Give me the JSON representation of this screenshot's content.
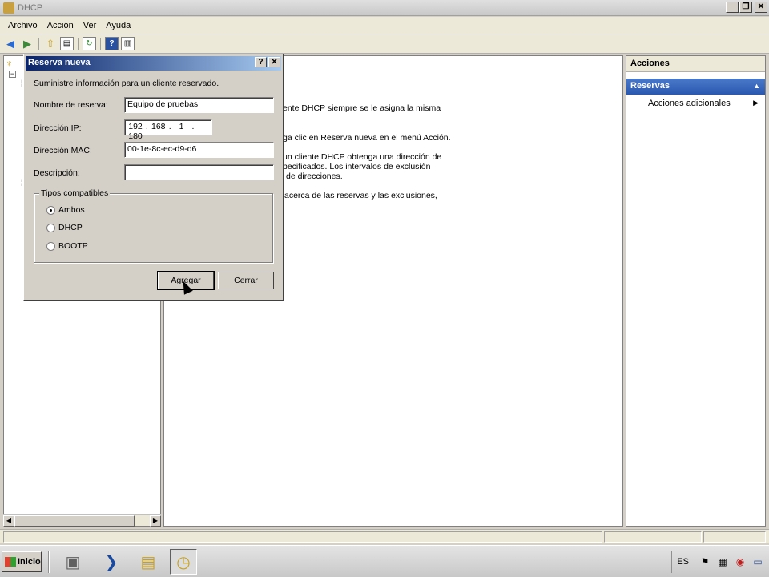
{
  "window": {
    "title": "DHCP",
    "min": "_",
    "restore": "❐",
    "close": "✕"
  },
  "menu": [
    "Archivo",
    "Acción",
    "Ver",
    "Ayuda"
  ],
  "center": {
    "lines": [
      "ente DHCP siempre se le asigna la misma",
      "ga clic en Reserva nueva en el menú Acción.",
      "un cliente DHCP obtenga una dirección de",
      "pecificados. Los intervalos de exclusión",
      "de direcciones.",
      "acerca de las reservas y las exclusiones,"
    ]
  },
  "actions": {
    "header": "Acciones",
    "section": "Reservas",
    "items": [
      "Acciones adicionales"
    ]
  },
  "dialog": {
    "title": "Reserva nueva",
    "help": "?",
    "close": "✕",
    "intro": "Suministre información para un cliente reservado.",
    "fields": {
      "name_label": "Nombre de reserva:",
      "name_value": "Equipo de pruebas",
      "ip_label": "Dirección IP:",
      "ip": [
        "192",
        "168",
        "1",
        "180"
      ],
      "mac_label": "Dirección MAC:",
      "mac_value": "00-1e-8c-ec-d9-d6",
      "desc_label": "Descripción:",
      "desc_value": ""
    },
    "types": {
      "legend": "Tipos compatibles",
      "options": [
        "Ambos",
        "DHCP",
        "BOOTP"
      ],
      "selected": "Ambos"
    },
    "buttons": {
      "add": "Agregar",
      "close": "Cerrar"
    }
  },
  "taskbar": {
    "start": "Inicio",
    "lang": "ES"
  }
}
